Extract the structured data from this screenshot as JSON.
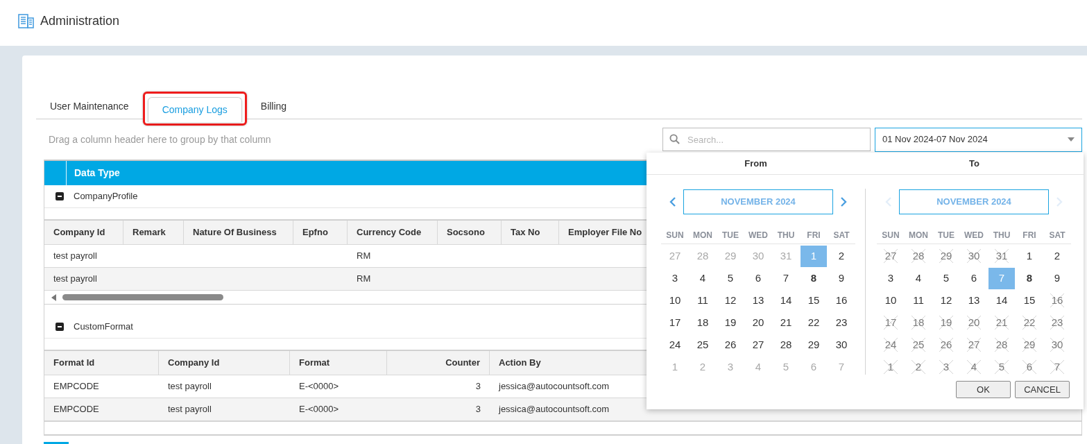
{
  "header": {
    "title": "Administration"
  },
  "tabs": [
    {
      "label": "User Maintenance",
      "selected": false,
      "highlighted": false
    },
    {
      "label": "Company Logs",
      "selected": true,
      "highlighted": true
    },
    {
      "label": "Billing",
      "selected": false,
      "highlighted": false
    }
  ],
  "group_panel": {
    "hint": "Drag a column header here to group by that column"
  },
  "search": {
    "placeholder": "Search..."
  },
  "date_range": {
    "value": "01 Nov 2024-07 Nov 2024"
  },
  "grid": {
    "columns": [
      "Data Type"
    ],
    "groups": [
      {
        "name": "CompanyProfile",
        "expanded": true,
        "scrollbar": true,
        "columns": [
          "Company Id",
          "Remark",
          "Nature Of Business",
          "Epfno",
          "Currency Code",
          "Socsono",
          "Tax No",
          "Employer File No"
        ],
        "rows": [
          [
            "test payroll",
            "",
            "",
            "",
            "RM",
            "",
            "",
            ""
          ],
          [
            "test payroll",
            "",
            "",
            "",
            "RM",
            "",
            "",
            ""
          ]
        ]
      },
      {
        "name": "CustomFormat",
        "expanded": true,
        "scrollbar": false,
        "columns": [
          "Format Id",
          "Company Id",
          "Format",
          "Counter",
          "Action By"
        ],
        "rows": [
          [
            "EMPCODE",
            "test payroll",
            "E-<0000>",
            "3",
            "jessica@autocountsoft.com"
          ],
          [
            "EMPCODE",
            "test payroll",
            "E-<0000>",
            "3",
            "jessica@autocountsoft.com"
          ]
        ]
      }
    ]
  },
  "date_picker": {
    "open": true,
    "calendars": [
      {
        "heading": "From",
        "month": "NOVEMBER 2024",
        "prev_enabled": true,
        "next_enabled": true,
        "weekdays": [
          "SUN",
          "MON",
          "TUE",
          "WED",
          "THU",
          "FRI",
          "SAT"
        ],
        "weeks": [
          [
            {
              "d": "27",
              "kind": "other",
              "selected": false
            },
            {
              "d": "28",
              "kind": "other",
              "selected": false
            },
            {
              "d": "29",
              "kind": "other",
              "selected": false
            },
            {
              "d": "30",
              "kind": "other",
              "selected": false
            },
            {
              "d": "31",
              "kind": "other",
              "selected": false
            },
            {
              "d": "1",
              "kind": "day",
              "selected": true
            },
            {
              "d": "2",
              "kind": "day",
              "selected": false
            }
          ],
          [
            {
              "d": "3",
              "kind": "day",
              "selected": false
            },
            {
              "d": "4",
              "kind": "day",
              "selected": false
            },
            {
              "d": "5",
              "kind": "day",
              "selected": false
            },
            {
              "d": "6",
              "kind": "day",
              "selected": false
            },
            {
              "d": "7",
              "kind": "day",
              "selected": false
            },
            {
              "d": "8",
              "kind": "today",
              "selected": false
            },
            {
              "d": "9",
              "kind": "day",
              "selected": false
            }
          ],
          [
            {
              "d": "10",
              "kind": "day",
              "selected": false
            },
            {
              "d": "11",
              "kind": "day",
              "selected": false
            },
            {
              "d": "12",
              "kind": "day",
              "selected": false
            },
            {
              "d": "13",
              "kind": "day",
              "selected": false
            },
            {
              "d": "14",
              "kind": "day",
              "selected": false
            },
            {
              "d": "15",
              "kind": "day",
              "selected": false
            },
            {
              "d": "16",
              "kind": "day",
              "selected": false
            }
          ],
          [
            {
              "d": "17",
              "kind": "day",
              "selected": false
            },
            {
              "d": "18",
              "kind": "day",
              "selected": false
            },
            {
              "d": "19",
              "kind": "day",
              "selected": false
            },
            {
              "d": "20",
              "kind": "day",
              "selected": false
            },
            {
              "d": "21",
              "kind": "day",
              "selected": false
            },
            {
              "d": "22",
              "kind": "day",
              "selected": false
            },
            {
              "d": "23",
              "kind": "day",
              "selected": false
            }
          ],
          [
            {
              "d": "24",
              "kind": "day",
              "selected": false
            },
            {
              "d": "25",
              "kind": "day",
              "selected": false
            },
            {
              "d": "26",
              "kind": "day",
              "selected": false
            },
            {
              "d": "27",
              "kind": "day",
              "selected": false
            },
            {
              "d": "28",
              "kind": "day",
              "selected": false
            },
            {
              "d": "29",
              "kind": "day",
              "selected": false
            },
            {
              "d": "30",
              "kind": "day",
              "selected": false
            }
          ],
          [
            {
              "d": "1",
              "kind": "other",
              "selected": false
            },
            {
              "d": "2",
              "kind": "other",
              "selected": false
            },
            {
              "d": "3",
              "kind": "other",
              "selected": false
            },
            {
              "d": "4",
              "kind": "other",
              "selected": false
            },
            {
              "d": "5",
              "kind": "other",
              "selected": false
            },
            {
              "d": "6",
              "kind": "other",
              "selected": false
            },
            {
              "d": "7",
              "kind": "other",
              "selected": false
            }
          ]
        ]
      },
      {
        "heading": "To",
        "month": "NOVEMBER 2024",
        "prev_enabled": false,
        "next_enabled": false,
        "weekdays": [
          "SUN",
          "MON",
          "TUE",
          "WED",
          "THU",
          "FRI",
          "SAT"
        ],
        "weeks": [
          [
            {
              "d": "27",
              "kind": "crossed",
              "selected": false
            },
            {
              "d": "28",
              "kind": "crossed",
              "selected": false
            },
            {
              "d": "29",
              "kind": "crossed",
              "selected": false
            },
            {
              "d": "30",
              "kind": "crossed",
              "selected": false
            },
            {
              "d": "31",
              "kind": "crossed",
              "selected": false
            },
            {
              "d": "1",
              "kind": "day",
              "selected": false
            },
            {
              "d": "2",
              "kind": "day",
              "selected": false
            }
          ],
          [
            {
              "d": "3",
              "kind": "day",
              "selected": false
            },
            {
              "d": "4",
              "kind": "day",
              "selected": false
            },
            {
              "d": "5",
              "kind": "day",
              "selected": false
            },
            {
              "d": "6",
              "kind": "day",
              "selected": false
            },
            {
              "d": "7",
              "kind": "day",
              "selected": true
            },
            {
              "d": "8",
              "kind": "today",
              "selected": false
            },
            {
              "d": "9",
              "kind": "day",
              "selected": false
            }
          ],
          [
            {
              "d": "10",
              "kind": "day",
              "selected": false
            },
            {
              "d": "11",
              "kind": "day",
              "selected": false
            },
            {
              "d": "12",
              "kind": "day",
              "selected": false
            },
            {
              "d": "13",
              "kind": "day",
              "selected": false
            },
            {
              "d": "14",
              "kind": "day",
              "selected": false
            },
            {
              "d": "15",
              "kind": "day",
              "selected": false
            },
            {
              "d": "16",
              "kind": "crossed",
              "selected": false
            }
          ],
          [
            {
              "d": "17",
              "kind": "crossed",
              "selected": false
            },
            {
              "d": "18",
              "kind": "crossed",
              "selected": false
            },
            {
              "d": "19",
              "kind": "crossed",
              "selected": false
            },
            {
              "d": "20",
              "kind": "crossed",
              "selected": false
            },
            {
              "d": "21",
              "kind": "crossed",
              "selected": false
            },
            {
              "d": "22",
              "kind": "crossed",
              "selected": false
            },
            {
              "d": "23",
              "kind": "crossed",
              "selected": false
            }
          ],
          [
            {
              "d": "24",
              "kind": "crossed",
              "selected": false
            },
            {
              "d": "25",
              "kind": "crossed",
              "selected": false
            },
            {
              "d": "26",
              "kind": "crossed",
              "selected": false
            },
            {
              "d": "27",
              "kind": "crossed",
              "selected": false
            },
            {
              "d": "28",
              "kind": "crossed",
              "selected": false
            },
            {
              "d": "29",
              "kind": "crossed",
              "selected": false
            },
            {
              "d": "30",
              "kind": "crossed",
              "selected": false
            }
          ],
          [
            {
              "d": "1",
              "kind": "crossed",
              "selected": false
            },
            {
              "d": "2",
              "kind": "crossed",
              "selected": false
            },
            {
              "d": "3",
              "kind": "crossed",
              "selected": false
            },
            {
              "d": "4",
              "kind": "crossed",
              "selected": false
            },
            {
              "d": "5",
              "kind": "crossed",
              "selected": false
            },
            {
              "d": "6",
              "kind": "crossed",
              "selected": false
            },
            {
              "d": "7",
              "kind": "crossed",
              "selected": false
            }
          ]
        ]
      }
    ],
    "buttons": [
      "OK",
      "CANCEL"
    ]
  }
}
